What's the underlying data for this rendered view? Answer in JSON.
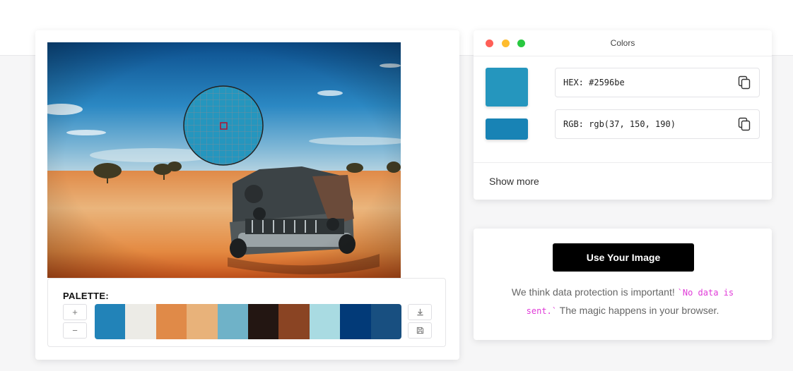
{
  "palette": {
    "title": "PALETTE:",
    "swatches": [
      "#2283b8",
      "#ecebe6",
      "#e08a48",
      "#e8b27a",
      "#6fb2c8",
      "#231612",
      "#8a4423",
      "#a9dbe2",
      "#023a78",
      "#184f80"
    ],
    "add_icon": "+",
    "remove_icon": "−",
    "download_icon": "download-icon",
    "save_icon": "save-icon"
  },
  "colors_panel": {
    "title": "Colors",
    "window_dots": [
      "#ff5f57",
      "#febc2e",
      "#28c840"
    ],
    "primary_swatch": "#2596be",
    "secondary_swatch": "#1883b5",
    "hex_label": "HEX: #2596be",
    "rgb_label": "RGB: rgb(37, 150, 190)",
    "show_more": "Show more"
  },
  "upload": {
    "button_label": "Use Your Image",
    "note_before": "We think data protection is important! ",
    "note_code": "`No data is sent.`",
    "note_after": " The magic happens in your browser."
  },
  "accent_color": "#e03ad8"
}
